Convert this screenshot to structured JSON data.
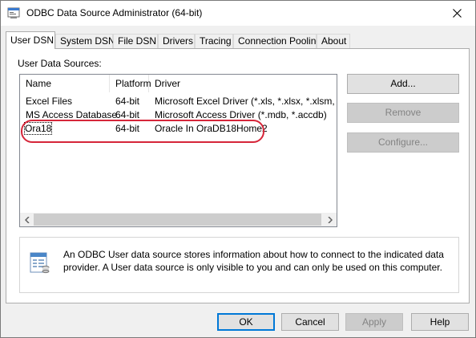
{
  "window": {
    "title": "ODBC Data Source Administrator (64-bit)"
  },
  "tabs": [
    {
      "label": "User DSN",
      "active": true
    },
    {
      "label": "System DSN",
      "active": false
    },
    {
      "label": "File DSN",
      "active": false
    },
    {
      "label": "Drivers",
      "active": false
    },
    {
      "label": "Tracing",
      "active": false
    },
    {
      "label": "Connection Pooling",
      "active": false
    },
    {
      "label": "About",
      "active": false
    }
  ],
  "panel": {
    "section_label": "User Data Sources:",
    "columns": [
      "Name",
      "Platform",
      "Driver"
    ],
    "rows": [
      {
        "name": "Excel Files",
        "platform": "64-bit",
        "driver": "Microsoft Excel Driver (*.xls, *.xlsx, *.xlsm, *.xlsb)"
      },
      {
        "name": "MS Access Database",
        "platform": "64-bit",
        "driver": "Microsoft Access Driver (*.mdb, *.accdb)"
      },
      {
        "name": "Ora18",
        "platform": "64-bit",
        "driver": "Oracle In OraDB18Home2",
        "focused": true
      }
    ],
    "side_buttons": {
      "add": "Add...",
      "remove": "Remove",
      "configure": "Configure..."
    },
    "info_text": "An ODBC User data source stores information about how to connect to the indicated data provider.  A User data source is only visible to you and can only be used on this computer.",
    "highlight_color": "#d6263a"
  },
  "footer": {
    "ok": "OK",
    "cancel": "Cancel",
    "apply": "Apply",
    "help": "Help"
  },
  "colors": {
    "focus_border": "#0078d7"
  }
}
